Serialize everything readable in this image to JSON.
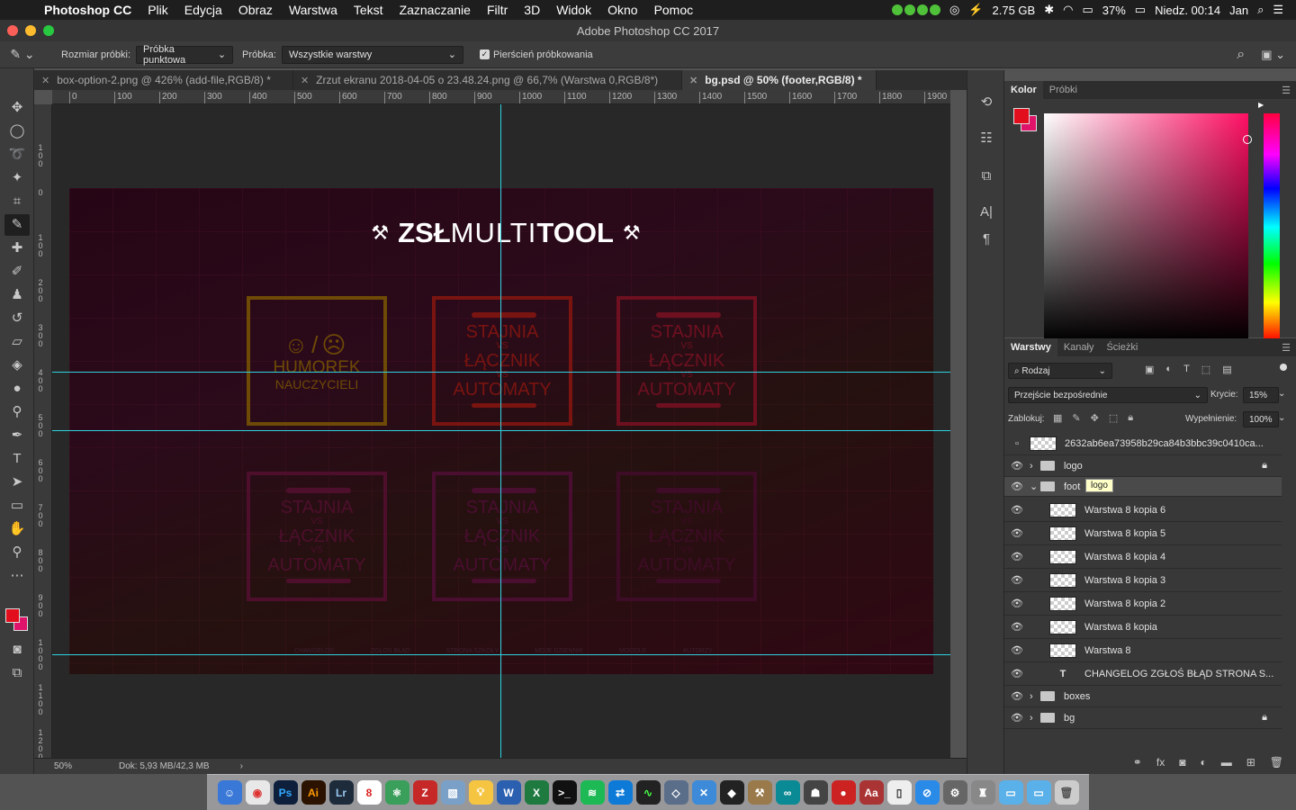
{
  "menubar": {
    "app_name": "Photoshop CC",
    "items": [
      "Plik",
      "Edycja",
      "Obraz",
      "Warstwa",
      "Tekst",
      "Zaznaczanie",
      "Filtr",
      "3D",
      "Widok",
      "Okno",
      "Pomoc"
    ],
    "memory": "2.75 GB",
    "battery": "37%",
    "clock": "Niedz. 00:14",
    "user": "Jan"
  },
  "window": {
    "title": "Adobe Photoshop CC 2017"
  },
  "options_bar": {
    "sample_size_label": "Rozmiar próbki:",
    "sample_size_value": "Próbka punktowa",
    "sample_label": "Próbka:",
    "sample_value": "Wszystkie warstwy",
    "ring_label": "Pierścień próbkowania"
  },
  "tabs": [
    {
      "label": "box-option-2.png @ 426% (add-file,RGB/8) *"
    },
    {
      "label": "Zrzut ekranu 2018-04-05 o 23.48.24.png @ 66,7% (Warstwa 0,RGB/8*)"
    },
    {
      "label": "bg.psd @ 50% (footer,RGB/8) *"
    }
  ],
  "ruler_h": [
    "0",
    "100",
    "200",
    "300",
    "400",
    "500",
    "600",
    "700",
    "800",
    "900",
    "1000",
    "1100",
    "1200",
    "1300",
    "1400",
    "1500",
    "1600",
    "1700",
    "1800",
    "1900"
  ],
  "ruler_v": [
    "100",
    "0",
    "100",
    "200",
    "300",
    "400",
    "500",
    "600",
    "700",
    "800",
    "900",
    "1000",
    "1100",
    "1200"
  ],
  "artwork": {
    "logo_bold_left": "ZSŁ",
    "logo_light": "MULTI",
    "logo_bold_right": "TOOL",
    "boxes": [
      {
        "kind": "humor",
        "line1": "HUMOREK",
        "line2": "NAUCZYCIELI",
        "color": "#6e4a06"
      },
      {
        "kind": "stajnia",
        "top": "STAJNIA",
        "vs1": "VS",
        "mid": "ŁĄCZNIK",
        "vs2": "VS",
        "bottom": "AUTOMATY",
        "color": "#7a1410"
      },
      {
        "kind": "stajnia",
        "top": "STAJNIA",
        "vs1": "VS",
        "mid": "ŁĄCZNIK",
        "vs2": "VS",
        "bottom": "AUTOMATY",
        "color": "#6e1020"
      },
      {
        "kind": "stajnia",
        "top": "STAJNIA",
        "vs1": "VS",
        "mid": "ŁĄCZNIK",
        "vs2": "VS",
        "bottom": "AUTOMATY",
        "color": "#4e0f2c"
      },
      {
        "kind": "stajnia",
        "top": "STAJNIA",
        "vs1": "VS",
        "mid": "ŁĄCZNIK",
        "vs2": "VS",
        "bottom": "AUTOMATY",
        "color": "#4a0e30"
      },
      {
        "kind": "stajnia",
        "top": "STAJNIA",
        "vs1": "VS",
        "mid": "ŁĄCZNIK",
        "vs2": "VS",
        "bottom": "AUTOMATY",
        "color": "#3e0c26"
      }
    ],
    "footer_links": [
      "CHANGELOG",
      "ZGŁOŚ BŁĄD",
      "STRONA SZKOŁY",
      "MOJE DZIENNIK",
      "MOODLE",
      "AUTORZY"
    ]
  },
  "status": {
    "zoom": "50%",
    "doc": "Dok: 5,93 MB/42,3 MB"
  },
  "color_panel": {
    "tabs": [
      "Kolor",
      "Próbki"
    ],
    "fg": "#e20e1d",
    "bg": "#e0136b"
  },
  "layers_panel": {
    "tabs": [
      "Warstwy",
      "Kanały",
      "Ścieżki"
    ],
    "filter_label": "Rodzaj",
    "blend_mode": "Przejście bezpośrednie",
    "opacity_label": "Krycie:",
    "opacity_value": "15%",
    "lock_label": "Zablokuj:",
    "fill_label": "Wypełnienie:",
    "fill_value": "100%",
    "tooltip": "logo",
    "layers": [
      {
        "name": "2632ab6ea73958b29ca84b3bbc39c0410ca...",
        "type": "image",
        "visible": false,
        "indent": 0,
        "locked": false
      },
      {
        "name": "logo",
        "type": "folder",
        "visible": true,
        "indent": 0,
        "locked": true,
        "expanded": false
      },
      {
        "name": "foot",
        "type": "folder",
        "visible": true,
        "indent": 0,
        "locked": false,
        "expanded": true,
        "selected": true
      },
      {
        "name": "Warstwa 8 kopia 6",
        "type": "image",
        "visible": true,
        "indent": 1
      },
      {
        "name": "Warstwa 8 kopia 5",
        "type": "image",
        "visible": true,
        "indent": 1
      },
      {
        "name": "Warstwa 8 kopia 4",
        "type": "image",
        "visible": true,
        "indent": 1
      },
      {
        "name": "Warstwa 8 kopia 3",
        "type": "image",
        "visible": true,
        "indent": 1
      },
      {
        "name": "Warstwa 8 kopia 2",
        "type": "image",
        "visible": true,
        "indent": 1
      },
      {
        "name": "Warstwa 8 kopia",
        "type": "image",
        "visible": true,
        "indent": 1
      },
      {
        "name": "Warstwa 8",
        "type": "image",
        "visible": true,
        "indent": 1
      },
      {
        "name": "CHANGELOG   ZGŁOŚ BŁĄD   STRONA S...",
        "type": "text",
        "visible": true,
        "indent": 1
      },
      {
        "name": "boxes",
        "type": "folder",
        "visible": true,
        "indent": 0,
        "locked": false,
        "expanded": false
      },
      {
        "name": "bg",
        "type": "folder",
        "visible": true,
        "indent": 0,
        "locked": true,
        "expanded": false
      }
    ]
  }
}
